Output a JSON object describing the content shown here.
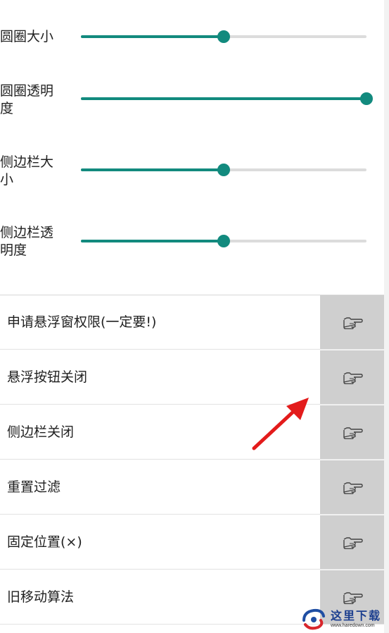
{
  "sliders": [
    {
      "label": "圆圈大小",
      "value": 0.5
    },
    {
      "label": "圆圈透明度",
      "value": 1.0
    },
    {
      "label": "侧边栏大小",
      "value": 0.5
    },
    {
      "label": "侧边栏透明度",
      "value": 0.5
    }
  ],
  "actions": [
    {
      "label": "申请悬浮窗权限(一定要!)",
      "icon": "pointing-hand-icon"
    },
    {
      "label": "悬浮按钮关闭",
      "icon": "pointing-hand-icon"
    },
    {
      "label": "侧边栏关闭",
      "icon": "pointing-hand-icon"
    },
    {
      "label": "重置过滤",
      "icon": "pointing-hand-icon"
    },
    {
      "label": "固定位置(×)",
      "icon": "pointing-hand-icon"
    },
    {
      "label": "旧移动算法",
      "icon": "pointing-hand-icon"
    }
  ],
  "watermark": {
    "text": "这里下载",
    "url": "www.haredown.com"
  },
  "colors": {
    "accent": "#128a7e",
    "track": "#dcdcdc",
    "button_bg": "#cfcfcf",
    "arrow": "#e31b1b"
  }
}
